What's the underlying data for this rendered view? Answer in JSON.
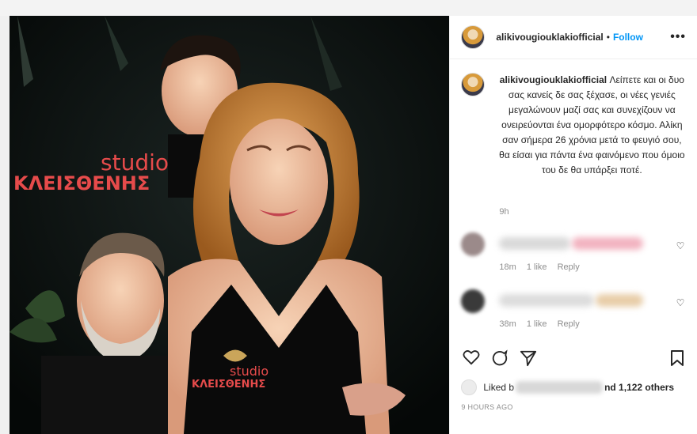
{
  "post": {
    "username": "alikivougiouklakiofficial",
    "follow_label": "Follow",
    "more_label": "•••",
    "caption_text": "Λείπετε και οι δυο σας κανείς δε σας ξέχασε, οι νέες γενιές μεγαλώνουν μαζί σας και συνεχίζουν να ονειρεύονται ένα ομορφότερο κόσμο. Αλίκη σαν σήμερα 26 χρόνια μετά το φευγιό σου, θα είσαι για πάντα ένα φαινόμενο που όμοιο του δε θα υπάρξει ποτέ.",
    "caption_time": "9h",
    "image_signs": [
      "studio",
      "ΚΛΕΙΣΘΕΝΗΣ"
    ],
    "comments": [
      {
        "time": "18m",
        "likes": "1 like",
        "reply": "Reply"
      },
      {
        "time": "38m",
        "likes": "1 like",
        "reply": "Reply"
      }
    ],
    "liked_by_prefix": "Liked b",
    "liked_by_suffix": "nd 1,122 others",
    "posted_ago": "9 HOURS AGO"
  },
  "icons": {
    "heart": "heart-icon",
    "comment": "comment-icon",
    "share": "share-icon",
    "save": "bookmark-icon"
  }
}
